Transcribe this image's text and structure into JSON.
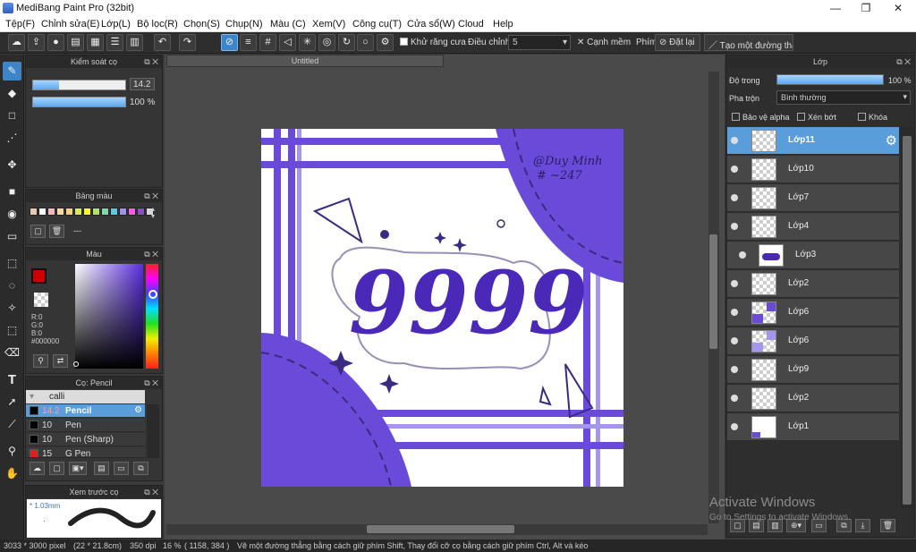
{
  "window": {
    "title": "MediBang Paint Pro (32bit)",
    "min": "—",
    "max": "❐",
    "close": "✕"
  },
  "menu": [
    "Tệp(F)",
    "Chỉnh sửa(E)",
    "Lớp(L)",
    "Bộ lọc(R)",
    "Chọn(S)",
    "Chụp(N)",
    "Màu (C)",
    "Xem(V)",
    "Công cụ(T)",
    "Cửa sổ(W)",
    "Cloud",
    "Help"
  ],
  "toolbar": {
    "antialias_label": "Khử răng cưa",
    "correction_label": "Điều chỉnh",
    "correction_value": "5",
    "soft_edge_label": "Cạnh mềm",
    "key_label": "Phím",
    "reset_label": "Đặt lại",
    "line_label": "Tạo một đường thẳng"
  },
  "brush_control": {
    "title": "Kiểm soát cọ",
    "size": "14.2",
    "size_fraction": 0.28,
    "opacity": "100 %",
    "opacity_fraction": 1.0
  },
  "palette": {
    "title": "Bảng màu",
    "empty_label": "---",
    "colors": [
      "#e8c8b0",
      "#ffffff",
      "#f4b8b8",
      "#f8d8a8",
      "#f4d080",
      "#d8e860",
      "#f8f830",
      "#b0e070",
      "#80d8a8",
      "#60c8e0",
      "#a090f0",
      "#f060e0",
      "#8850c0",
      "#d8d8d8"
    ]
  },
  "color": {
    "title": "Màu",
    "fg": "#cc0000",
    "r": "R:0",
    "g": "G:0",
    "b": "B:0",
    "hex": "#000000"
  },
  "brush_list": {
    "title": "Cọ: Pencil",
    "group": "calli",
    "items": [
      {
        "size": "14.2",
        "name": "Pencil",
        "color": "#000000"
      },
      {
        "size": "10",
        "name": "Pen",
        "color": "#000000"
      },
      {
        "size": "10",
        "name": "Pen (Sharp)",
        "color": "#000000"
      },
      {
        "size": "15",
        "name": "G Pen",
        "color": "#e02020"
      }
    ]
  },
  "preview": {
    "title": "Xem trước cọ",
    "size": "1.03mm"
  },
  "document": {
    "tab": "Untitled"
  },
  "artwork": {
    "number_text": "9999",
    "signature_line1": "@Duy Minh",
    "signature_line2": "# ~247"
  },
  "layers": {
    "title": "Lớp",
    "opacity_label": "Độ trong",
    "opacity_value": "100 %",
    "opacity_fraction": 1.0,
    "blend_label": "Pha trộn",
    "blend_value": "Bình thường",
    "protect_alpha": "Bảo vệ alpha",
    "clip": "Xén bớt",
    "lock": "Khóa",
    "items": [
      "Lớp11",
      "Lớp10",
      "Lớp7",
      "Lớp4",
      "Lớp3",
      "Lớp2",
      "Lớp6",
      "Lớp6",
      "Lớp9",
      "Lớp2",
      "Lớp1"
    ]
  },
  "status": {
    "size": "3033 * 3000 pixel",
    "cm": "(22 * 21.8cm)",
    "dpi": "350 dpi",
    "zoom": "16 %",
    "coords": "( 1158, 384 )",
    "hint": "Vẽ một đường thẳng bằng cách giữ phím Shift, Thay đổi cỡ cọ bằng cách giữ phím Ctrl, Alt và kéo"
  },
  "activation": {
    "line1": "Activate Windows",
    "line2": "Go to Settings to activate Windows."
  }
}
